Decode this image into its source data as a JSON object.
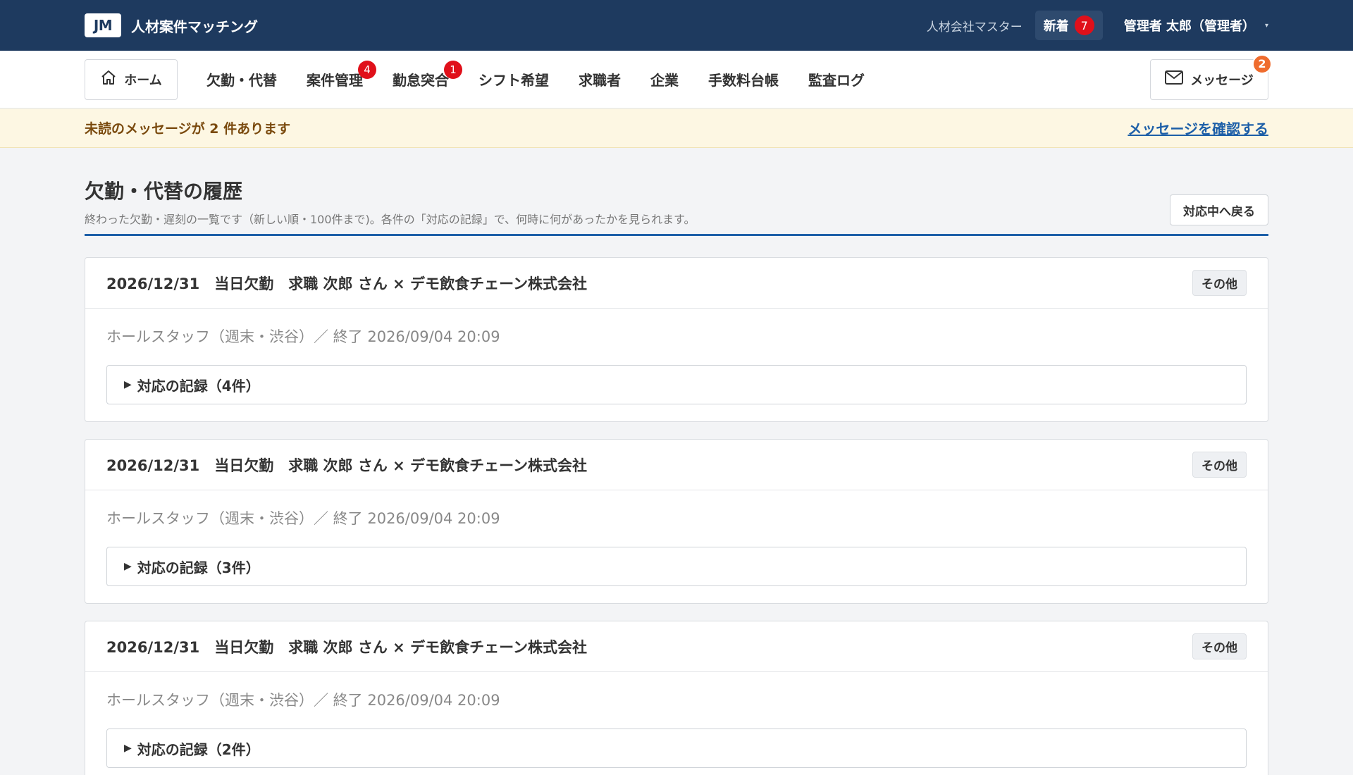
{
  "header": {
    "logo": "JM",
    "app_name": "人材案件マッチング",
    "company": "人材会社マスター",
    "new_label": "新着",
    "new_count": "7",
    "user": "管理者 太郎（管理者）",
    "caret": "▾"
  },
  "nav": {
    "home": "ホーム",
    "items": [
      {
        "label": "欠勤・代替",
        "badge": ""
      },
      {
        "label": "案件管理",
        "badge": "4"
      },
      {
        "label": "勤怠突合",
        "badge": "1"
      },
      {
        "label": "シフト希望",
        "badge": ""
      },
      {
        "label": "求職者",
        "badge": ""
      },
      {
        "label": "企業",
        "badge": ""
      },
      {
        "label": "手数料台帳",
        "badge": ""
      },
      {
        "label": "監査ログ",
        "badge": ""
      }
    ],
    "messages": "メッセージ",
    "messages_badge": "2"
  },
  "notice": {
    "text": "未読のメッセージが 2 件あります",
    "link": "メッセージを確認する"
  },
  "page": {
    "title": "欠勤・代替の履歴",
    "description": "終わった欠勤・遅刻の一覧です（新しい順・100件まで)。各件の「対応の記録」で、何時に何があったかを見られます。",
    "back_button": "対応中へ戻る"
  },
  "records": [
    {
      "title": "2026/12/31　当日欠勤　求職 次郎 さん × デモ飲食チェーン株式会社",
      "tag": "その他",
      "meta": "ホールスタッフ（週末・渋谷）／ 終了 2026/09/04 20:09",
      "log": "対応の記録（4件）"
    },
    {
      "title": "2026/12/31　当日欠勤　求職 次郎 さん × デモ飲食チェーン株式会社",
      "tag": "その他",
      "meta": "ホールスタッフ（週末・渋谷）／ 終了 2026/09/04 20:09",
      "log": "対応の記録（3件）"
    },
    {
      "title": "2026/12/31　当日欠勤　求職 次郎 さん × デモ飲食チェーン株式会社",
      "tag": "その他",
      "meta": "ホールスタッフ（週末・渋谷）／ 終了 2026/09/04 20:09",
      "log": "対応の記録（2件）"
    }
  ]
}
